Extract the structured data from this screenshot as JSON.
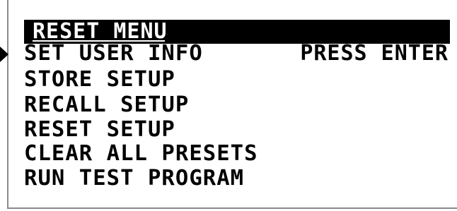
{
  "menu": {
    "title": "RESET MENU",
    "items": [
      {
        "label": "SET USER INFO"
      },
      {
        "label": "STORE SETUP"
      },
      {
        "label": "RECALL  SETUP"
      },
      {
        "label": "RESET SETUP"
      },
      {
        "label": "CLEAR ALL PRESETS"
      },
      {
        "label": "RUN TEST PROGRAM"
      }
    ],
    "selected_item_status": "PRESS ENTER"
  },
  "colors": {
    "background": "#ffffff",
    "text": "#000000",
    "title_bar": "#000000",
    "frame": "#8a8a8a"
  },
  "icons": {
    "selector": "play-arrow-icon"
  }
}
